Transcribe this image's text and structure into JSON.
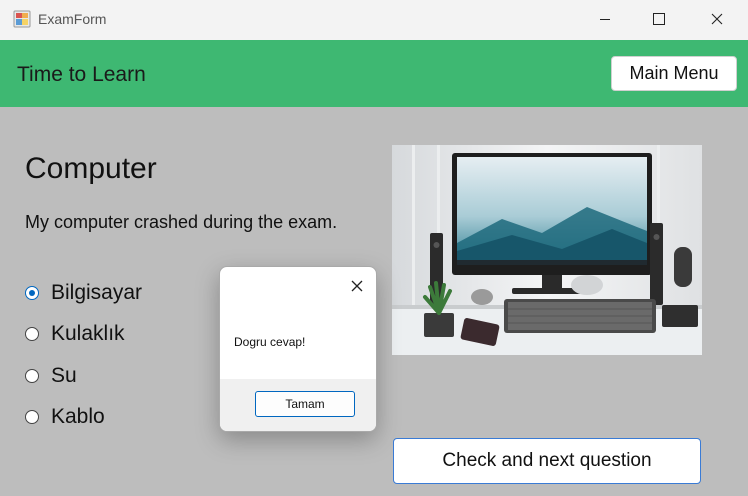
{
  "window": {
    "title": "ExamForm",
    "icon": "winforms-app-icon"
  },
  "header": {
    "title": "Time to Learn",
    "main_menu_label": "Main Menu",
    "color": "#3eb872"
  },
  "question": {
    "title": "Computer",
    "text": "My computer crashed during the exam.",
    "options": [
      {
        "label": "Bilgisayar",
        "selected": true
      },
      {
        "label": "Kulaklık",
        "selected": false
      },
      {
        "label": "Su",
        "selected": false
      },
      {
        "label": "Kablo",
        "selected": false
      }
    ],
    "image": "computer-desk-photo",
    "check_button_label": "Check and next question"
  },
  "dialog": {
    "message": "Dogru cevap!",
    "ok_label": "Tamam"
  }
}
